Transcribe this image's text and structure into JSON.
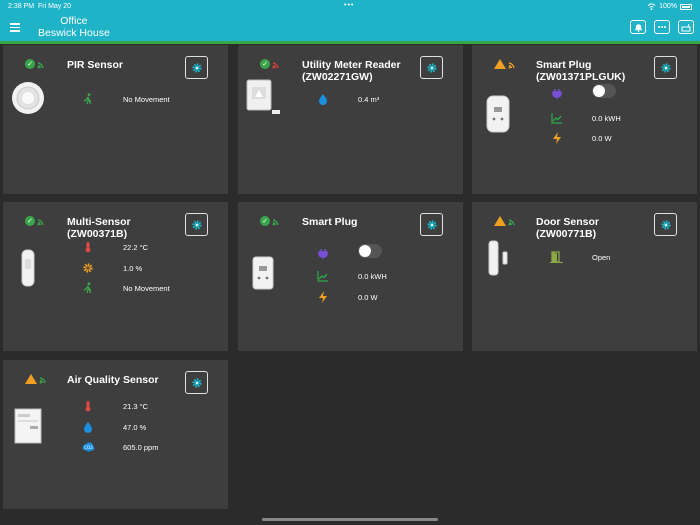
{
  "status_bar": {
    "time": "2:38 PM",
    "date": "Fri May 20",
    "dots": "•••",
    "battery": "100%"
  },
  "header": {
    "location": "Office",
    "site": "Beswick House",
    "icons": [
      "bell-icon",
      "more-icon",
      "hub-icon"
    ]
  },
  "colors": {
    "accent": "#1fb3c8",
    "ok": "#3aa64a",
    "warning": "#f0a020",
    "card": "#3e3e3e"
  },
  "cards": [
    {
      "title_line1": "PIR Sensor",
      "title_line2": "",
      "status": "ok",
      "rows": [
        {
          "icon": "motion-icon",
          "value": "No Movement"
        }
      ]
    },
    {
      "title_line1": "Utility Meter Reader",
      "title_line2": "(ZW02271GW)",
      "status": "ok",
      "rows": [
        {
          "icon": "water-drop-icon",
          "value": "0.4 m³"
        }
      ]
    },
    {
      "title_line1": "Smart Plug",
      "title_line2": "(ZW01371PLGUK)",
      "status": "warning",
      "rows": [
        {
          "icon": "plug-icon",
          "value": ""
        },
        {
          "icon": "energy-chart-icon",
          "value": "0.0 kWH"
        },
        {
          "icon": "power-bolt-icon",
          "value": "0.0 W"
        }
      ]
    },
    {
      "title_line1": "Multi-Sensor",
      "title_line2": "(ZW00371B)",
      "status": "ok",
      "rows": [
        {
          "icon": "thermometer-icon",
          "value": "22.2 °C"
        },
        {
          "icon": "brightness-icon",
          "value": "1.0 %"
        },
        {
          "icon": "motion-icon",
          "value": "No Movement"
        }
      ]
    },
    {
      "title_line1": "Smart Plug",
      "title_line2": "",
      "status": "ok",
      "rows": [
        {
          "icon": "plug-icon",
          "value": ""
        },
        {
          "icon": "energy-chart-icon",
          "value": "0.0 kWH"
        },
        {
          "icon": "power-bolt-icon",
          "value": "0.0 W"
        }
      ]
    },
    {
      "title_line1": "Door Sensor",
      "title_line2": "(ZW00771B)",
      "status": "warning",
      "rows": [
        {
          "icon": "door-icon",
          "value": "Open"
        }
      ]
    },
    {
      "title_line1": "Air Quality Sensor",
      "title_line2": "",
      "status": "warning",
      "rows": [
        {
          "icon": "thermometer-icon",
          "value": "21.3 °C"
        },
        {
          "icon": "humidity-icon",
          "value": "47.0 %"
        },
        {
          "icon": "co2-icon",
          "value": "605.0 ppm"
        }
      ]
    }
  ]
}
